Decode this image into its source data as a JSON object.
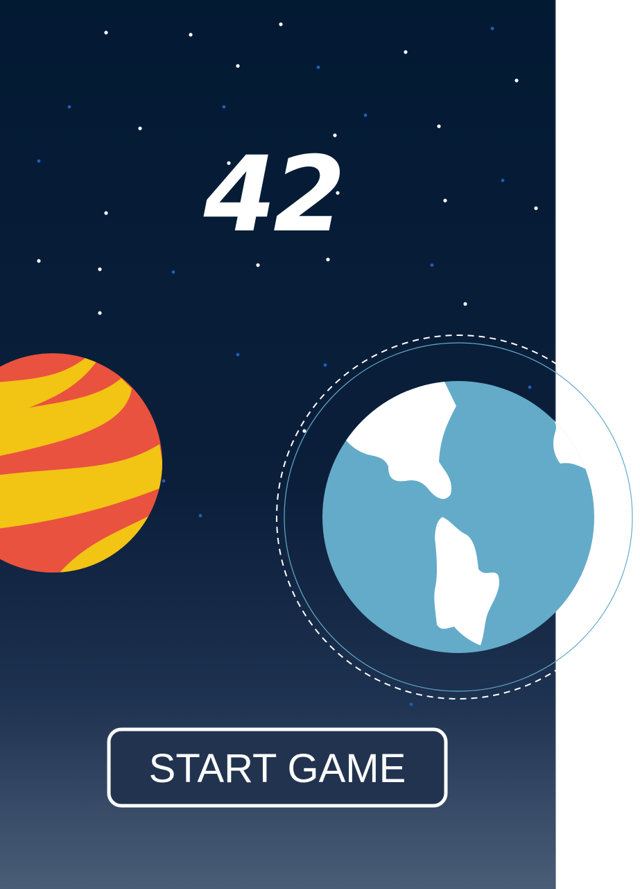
{
  "score": "42",
  "start_button": {
    "label": "START GAME"
  },
  "colors": {
    "space_top": "#031a33",
    "space_mid": "#102340",
    "space_bottom": "#475a73",
    "star_white": "#ffffff",
    "star_blue": "#1e5fb8",
    "planet_red": "#e9523f",
    "planet_yellow": "#f2c414",
    "earth_ocean": "#64abc9",
    "earth_land": "#ffffff",
    "orbit_line": "#64abc9",
    "orbit_dashes": "#ffffff",
    "button_border": "#ffffff",
    "button_fill": "#22334f",
    "button_text": "#ffffff"
  }
}
